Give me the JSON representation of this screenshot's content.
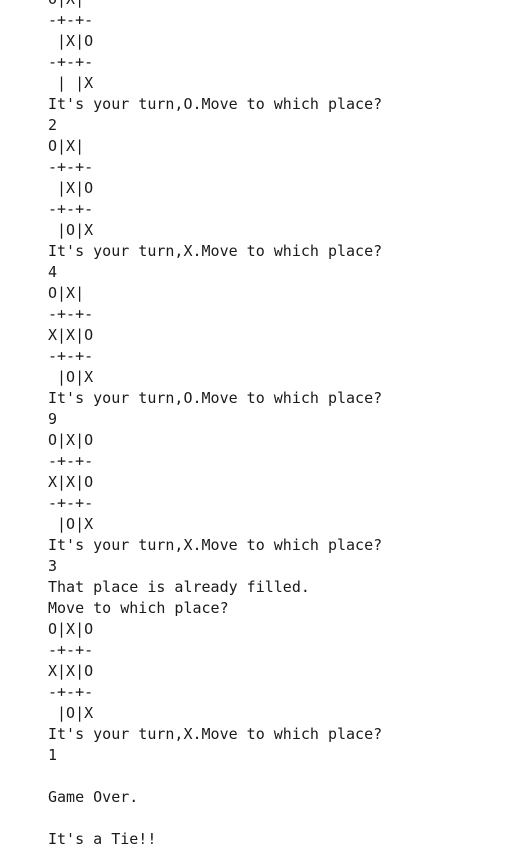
{
  "console": {
    "lines": [
      "O|X|",
      "-+-+-",
      " |X|O",
      "-+-+-",
      " | |X",
      "It's your turn,O.Move to which place?",
      "2",
      "O|X|",
      "-+-+-",
      " |X|O",
      "-+-+-",
      " |O|X",
      "It's your turn,X.Move to which place?",
      "4",
      "O|X|",
      "-+-+-",
      "X|X|O",
      "-+-+-",
      " |O|X",
      "It's your turn,O.Move to which place?",
      "9",
      "O|X|O",
      "-+-+-",
      "X|X|O",
      "-+-+-",
      " |O|X",
      "It's your turn,X.Move to which place?",
      "3",
      "That place is already filled.",
      "Move to which place?",
      "O|X|O",
      "-+-+-",
      "X|X|O",
      "-+-+-",
      " |O|X",
      "It's your turn,X.Move to which place?",
      "1",
      "",
      "Game Over.",
      "",
      "It's a Tie!!"
    ]
  }
}
